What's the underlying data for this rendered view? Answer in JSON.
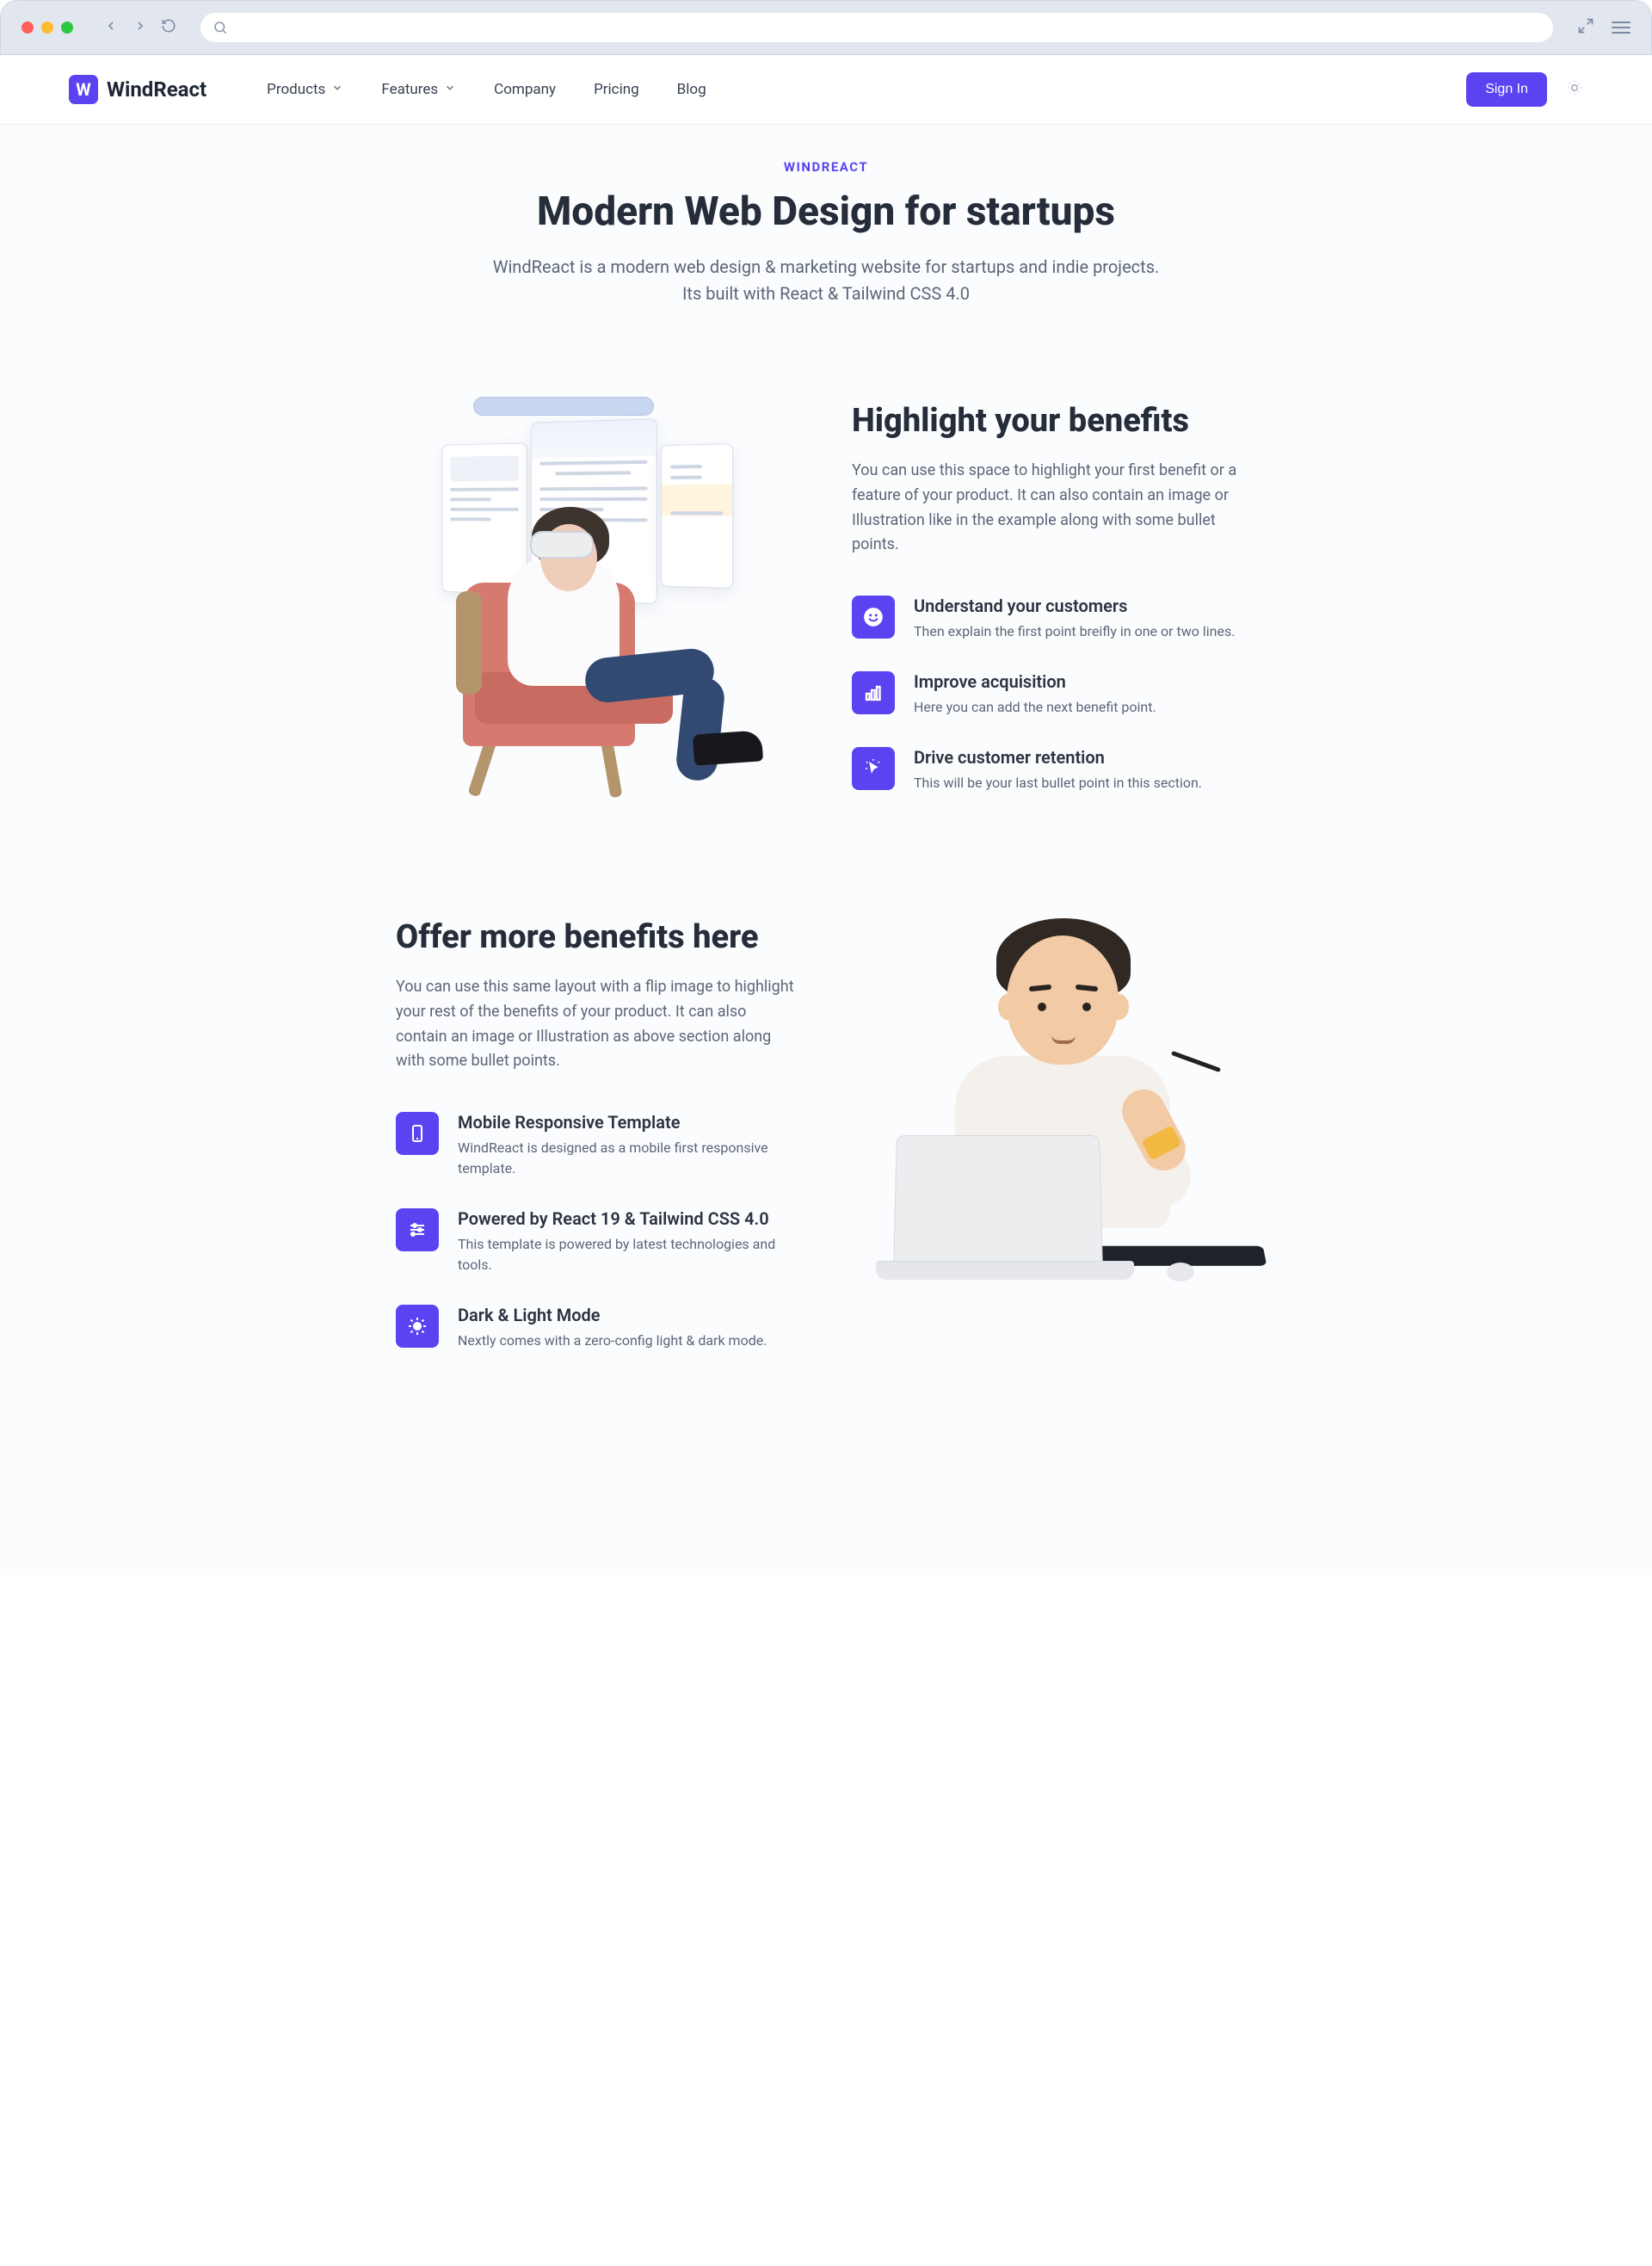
{
  "brand": {
    "name": "WindReact",
    "mark": "W"
  },
  "nav": {
    "items": [
      {
        "label": "Products",
        "dropdown": true
      },
      {
        "label": "Features",
        "dropdown": true
      },
      {
        "label": "Company",
        "dropdown": false
      },
      {
        "label": "Pricing",
        "dropdown": false
      },
      {
        "label": "Blog",
        "dropdown": false
      }
    ],
    "signin": "Sign In"
  },
  "intro": {
    "eyebrow": "WINDREACT",
    "heading": "Modern Web Design for startups",
    "sub": "WindReact is a modern web design & marketing website for startups and indie projects. Its built with React & Tailwind CSS 4.0"
  },
  "section1": {
    "heading": "Highlight your benefits",
    "desc": "You can use this space to highlight your first benefit or a feature of your product. It can also contain an image or Illustration like in the example along with some bullet points.",
    "bullets": [
      {
        "icon": "smile-icon",
        "title": "Understand your customers",
        "desc": "Then explain the first point breifly in one or two lines."
      },
      {
        "icon": "chart-icon",
        "title": "Improve acquisition",
        "desc": "Here you can add the next benefit point."
      },
      {
        "icon": "cursor-icon",
        "title": "Drive customer retention",
        "desc": "This will be your last bullet point in this section."
      }
    ]
  },
  "section2": {
    "heading": "Offer more benefits here",
    "desc": "You can use this same layout with a flip image to highlight your rest of the benefits of your product. It can also contain an image or Illustration as above section along with some bullet points.",
    "bullets": [
      {
        "icon": "mobile-icon",
        "title": "Mobile Responsive Template",
        "desc": "WindReact is designed as a mobile first responsive template."
      },
      {
        "icon": "sliders-icon",
        "title": "Powered by React 19 & Tailwind CSS 4.0",
        "desc": "This template is powered by latest technologies and tools."
      },
      {
        "icon": "sun-icon",
        "title": "Dark & Light Mode",
        "desc": "Nextly comes with a zero-config light & dark mode."
      }
    ]
  },
  "colors": {
    "accent": "#5b43f1"
  }
}
